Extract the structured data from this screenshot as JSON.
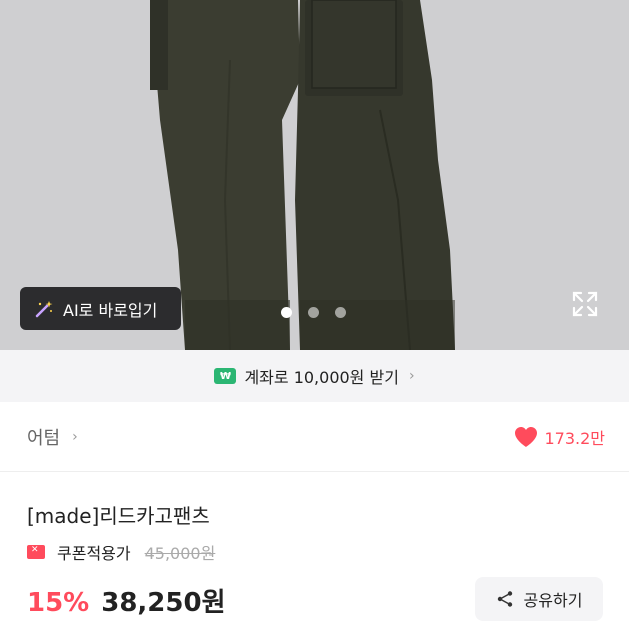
{
  "hero": {
    "ai_button_label": "AI로 바로입기",
    "carousel_dots": 3,
    "active_dot": 0
  },
  "promo": {
    "badge": "₩",
    "text": "계좌로 10,000원 받기"
  },
  "store": {
    "name": "어텀",
    "likes": "173.2만"
  },
  "product": {
    "title": "[made]리드카고팬츠",
    "coupon_label": "쿠폰적용가",
    "original_price": "45,000원",
    "discount": "15%",
    "price": "38,250원"
  },
  "share": {
    "label": "공유하기"
  },
  "colors": {
    "accent": "#ff4b5c",
    "promo_green": "#2bb673",
    "pants": "#3a3c30"
  }
}
